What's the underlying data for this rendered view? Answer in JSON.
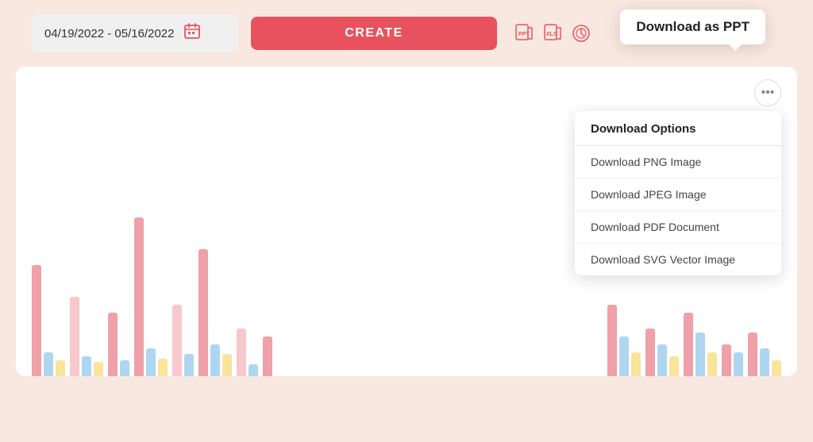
{
  "tooltip": {
    "text": "Download as PPT"
  },
  "topbar": {
    "date_range": "04/19/2022 - 05/16/2022",
    "create_label": "CREATE"
  },
  "toolbar": {
    "ppt_icon_label": "PPT",
    "xls_icon_label": "XLS",
    "schedule_icon_label": "Schedule"
  },
  "chart": {
    "dots_label": "···",
    "download_options_header": "Download Options",
    "menu_items": [
      {
        "label": "Download PNG Image",
        "id": "png"
      },
      {
        "label": "Download JPEG Image",
        "id": "jpeg"
      },
      {
        "label": "Download PDF Document",
        "id": "pdf"
      },
      {
        "label": "Download SVG Vector Image",
        "id": "svg"
      }
    ]
  },
  "colors": {
    "accent": "#e8525f",
    "pink_bar": "#f0a0a8",
    "light_bar": "#f7c8cc",
    "blue_bar": "#aed6f1",
    "yellow_bar": "#f9e49a"
  }
}
